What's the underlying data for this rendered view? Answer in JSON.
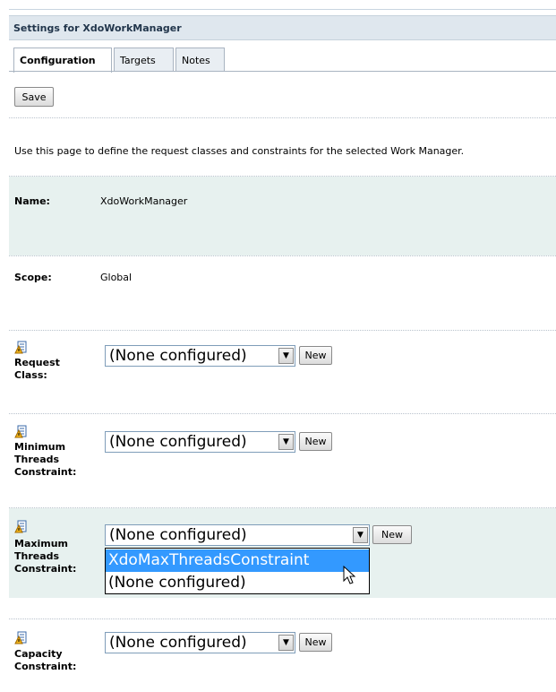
{
  "title": "Settings for XdoWorkManager",
  "tabs": [
    {
      "label": "Configuration",
      "active": true
    },
    {
      "label": "Targets",
      "active": false
    },
    {
      "label": "Notes",
      "active": false
    }
  ],
  "save_label": "Save",
  "description": "Use this page to define the request classes and constraints for the selected Work Manager.",
  "name": {
    "label": "Name:",
    "value": "XdoWorkManager"
  },
  "scope": {
    "label": "Scope:",
    "value": "Global"
  },
  "request_class": {
    "label_lines": [
      "Request",
      "Class:"
    ],
    "selected": "(None configured)",
    "new_label": "New"
  },
  "min_threads": {
    "label_lines": [
      "Minimum",
      "Threads",
      "Constraint:"
    ],
    "selected": "(None configured)",
    "new_label": "New"
  },
  "max_threads": {
    "label_lines": [
      "Maximum",
      "Threads",
      "Constraint:"
    ],
    "selected": "(None configured)",
    "new_label": "New",
    "options": [
      "XdoMaxThreadsConstraint",
      "(None configured)"
    ],
    "highlighted_option": "XdoMaxThreadsConstraint"
  },
  "capacity": {
    "label_lines": [
      "Capacity",
      "Constraint:"
    ],
    "selected": "(None configured)",
    "new_label": "New"
  },
  "colors": {
    "title_bg": "#dfe7ee",
    "shaded_row": "#e7f1ef",
    "highlight": "#3399ff"
  }
}
